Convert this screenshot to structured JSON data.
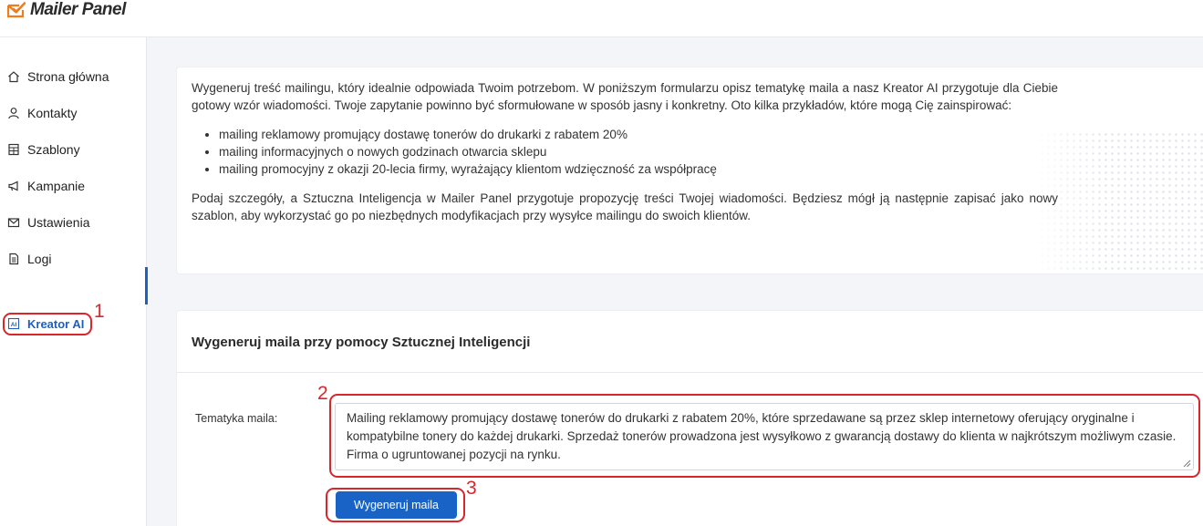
{
  "app": {
    "title": "Mailer Panel"
  },
  "sidebar": {
    "items": [
      {
        "label": "Strona główna",
        "icon": "home-icon"
      },
      {
        "label": "Kontakty",
        "icon": "user-icon"
      },
      {
        "label": "Szablony",
        "icon": "template-icon"
      },
      {
        "label": "Kampanie",
        "icon": "megaphone-icon"
      },
      {
        "label": "Ustawienia",
        "icon": "envelope-icon"
      },
      {
        "label": "Logi",
        "icon": "document-icon"
      }
    ],
    "active_item": {
      "label": "Kreator AI",
      "icon": "ai-icon"
    }
  },
  "info": {
    "intro": "Wygeneruj treść mailingu, który idealnie odpowiada Twoim potrzebom. W poniższym formularzu opisz tematykę maila a nasz Kreator AI przygotuje dla Ciebie gotowy wzór wiadomości. Twoje zapytanie powinno być sformułowane w sposób jasny i konkretny. Oto kilka przykładów, które mogą Cię zainspirować:",
    "examples": [
      "mailing reklamowy promujący dostawę tonerów do drukarki z rabatem 20%",
      "mailing informacyjnych o nowych godzinach otwarcia sklepu",
      "mailing promocyjny z okazji 20-lecia firmy, wyrażający klientom wdzięczność za współpracę"
    ],
    "outro": "Podaj szczegóły, a Sztuczna Inteligencja w Mailer Panel przygotuje propozycję treści Twojej wiadomości. Będziesz mógł ją następnie zapisać jako nowy szablon, aby wykorzystać go po niezbędnych modyfikacjach przy wysyłce mailingu do swoich klientów."
  },
  "form": {
    "title": "Wygeneruj maila przy pomocy Sztucznej Inteligencji",
    "topic_label": "Tematyka maila:",
    "topic_value": "Mailing reklamowy promujący dostawę tonerów do drukarki z rabatem 20%, które sprzedawane są przez sklep internetowy oferujący oryginalne i kompatybilne tonery do każdej drukarki. Sprzedaż tonerów prowadzona jest wysyłkowo z gwarancją dostawy do klienta w najkrótszym możliwym czasie. Firma o ugruntowanej pozycji na rynku.",
    "generate_label": "Wygeneruj maila"
  },
  "annotations": {
    "one": "1",
    "two": "2",
    "three": "3"
  },
  "colors": {
    "accent": "#1a63c6",
    "logo": "#f07c1c",
    "annotation": "#d8262b"
  }
}
